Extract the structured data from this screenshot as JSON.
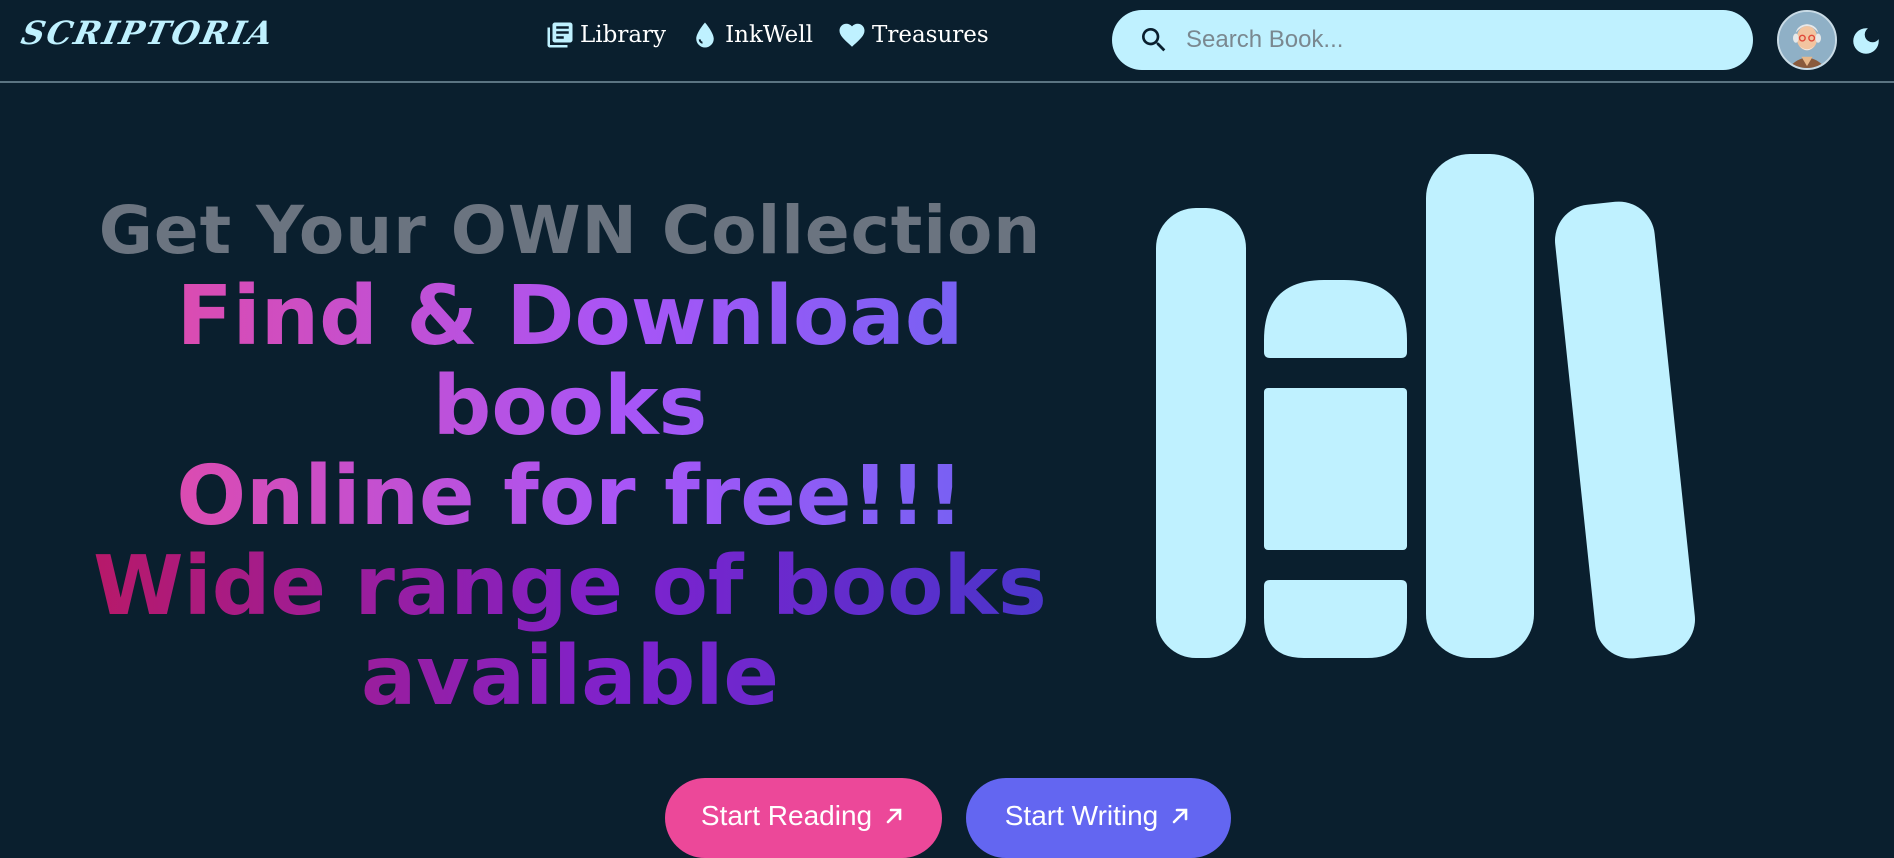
{
  "nav": {
    "logo": "SCRIPTORIA",
    "links": [
      {
        "label": "Library",
        "icon": "library-icon"
      },
      {
        "label": "InkWell",
        "icon": "ink-drop-icon"
      },
      {
        "label": "Treasures",
        "icon": "heart-icon"
      }
    ],
    "search": {
      "placeholder": "Search Book...",
      "value": ""
    }
  },
  "hero": {
    "subtitle": "Get Your OWN Collection",
    "headline1_line1": "Find & Download books",
    "headline1_line2": "Online for free!!!",
    "headline2_line1": "Wide range of books",
    "headline2_line2": "available"
  },
  "actions": {
    "start_reading": "Start Reading",
    "start_writing": "Start Writing"
  },
  "colors": {
    "background": "#0a1f2e",
    "accent_light": "#bff1ff",
    "pink": "#ec4899",
    "indigo": "#6366f1"
  }
}
